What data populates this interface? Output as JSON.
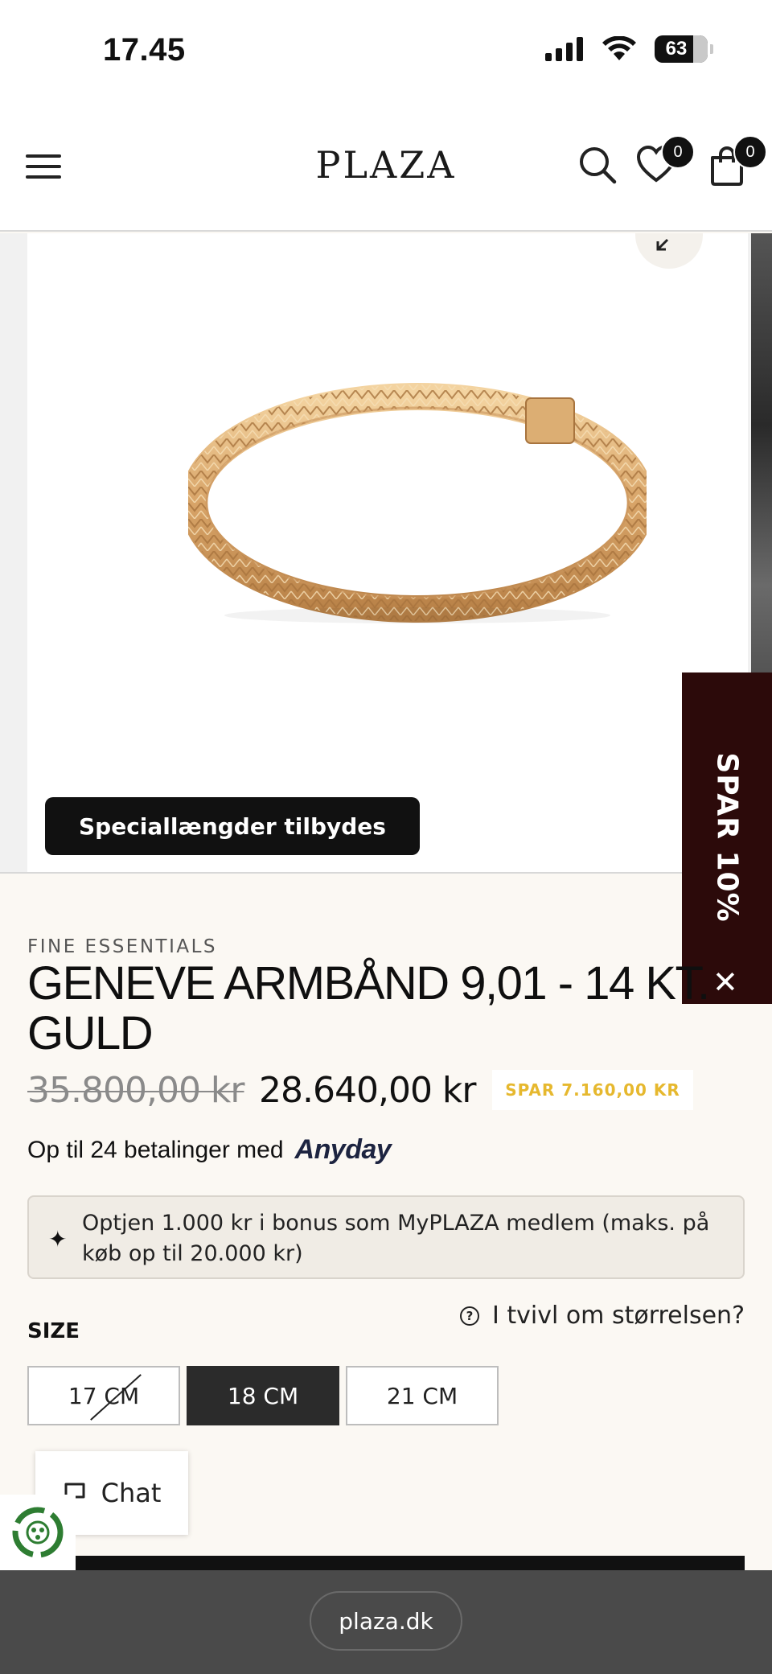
{
  "status": {
    "time": "17.45",
    "battery": "63"
  },
  "header": {
    "logo": "PLAZA",
    "wishlist_count": "0",
    "cart_count": "0"
  },
  "gallery": {
    "special_tag": "Speciallængder tilbydes"
  },
  "promo": {
    "label": "SPAR 10%",
    "close": "✕"
  },
  "product": {
    "brand": "FINE ESSENTIALS",
    "title_line1": "GENEVE ARMBÅND 9,01 - 14 KT.",
    "title_line2": "GULD",
    "old_price": "35.800,00 kr",
    "price": "28.640,00 kr",
    "save_badge": "SPAR 7.160,00 KR",
    "payment_text": "Op til 24 betalinger med",
    "payment_provider": "Anyday",
    "bonus_text": "Optjen 1.000 kr i bonus som MyPLAZA medlem (maks. på køb op til 20.000 kr)"
  },
  "size": {
    "label": "SIZE",
    "help_text": "I tvivl om størrelsen?",
    "options": [
      {
        "label": "17 CM",
        "state": "unavailable"
      },
      {
        "label": "18 CM",
        "state": "selected"
      },
      {
        "label": "21 CM",
        "state": "available"
      }
    ]
  },
  "chat": {
    "label": "Chat"
  },
  "browser": {
    "url": "plaza.dk"
  },
  "colors": {
    "promo_bg": "#2c0a0a",
    "save_badge_text": "#e6b82e",
    "page_bg": "#fbf8f3",
    "selected_size": "#2b2b2b"
  },
  "icons": [
    "menu-icon",
    "search-icon",
    "heart-icon",
    "cart-icon",
    "zoom-icon",
    "sparkle-icon",
    "help-circle-icon",
    "chat-bubble-icon",
    "eco-icon",
    "signal-icon",
    "wifi-icon"
  ]
}
